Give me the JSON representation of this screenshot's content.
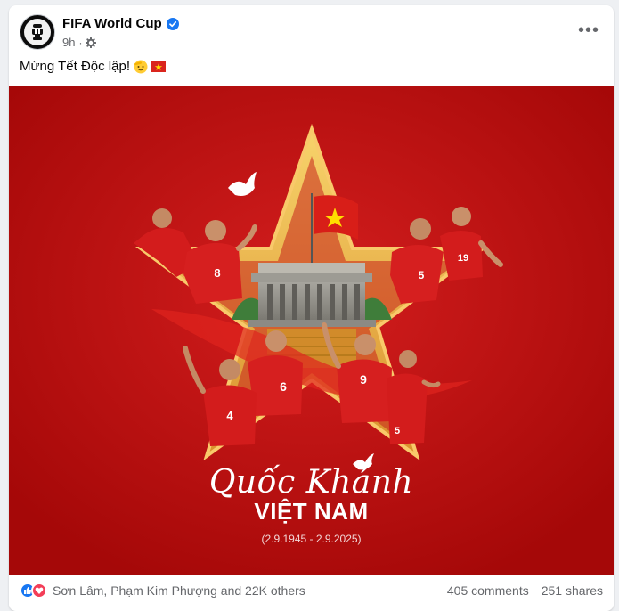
{
  "post": {
    "page_name": "FIFA World Cup",
    "time": "9h",
    "caption_text": "Mừng Tết Độc lập!",
    "caption_emojis": [
      "saluting-face",
      "vietnam-flag"
    ]
  },
  "artwork": {
    "script_title": "Quốc Khánh",
    "main_title": "VIỆT NAM",
    "dates": "(2.9.1945 - 2.9.2025)",
    "jersey_numbers": [
      "8",
      "5",
      "19",
      "6",
      "4",
      "9",
      "5"
    ]
  },
  "footer": {
    "reactions_text": "Sơn Lâm, Phạm Kim Phượng and 22K others",
    "comments": "405 comments",
    "shares": "251 shares"
  },
  "colors": {
    "background_red": "#ad0a0a",
    "star_gold": "#f3c04a",
    "facebook_blue": "#1877f2",
    "love_red": "#f33e58"
  }
}
